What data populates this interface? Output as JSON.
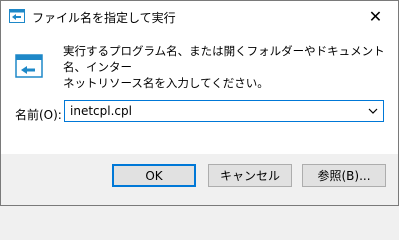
{
  "window": {
    "title": "ファイル名を指定して実行",
    "close_glyph": "✕"
  },
  "dialog": {
    "description_line1": "実行するプログラム名、または開くフォルダーやドキュメント名、インター",
    "description_line2": "ネットリソース名を入力してください。",
    "name_label": "名前(O):",
    "input_value": "inetcpl.cpl"
  },
  "buttons": {
    "ok_label": "OK",
    "cancel_label": "キャンセル",
    "browse_label": "参照(B)..."
  },
  "colors": {
    "accent": "#0078d7",
    "title_bg": "#ffffff",
    "footer_bg": "#f0f0f0"
  }
}
